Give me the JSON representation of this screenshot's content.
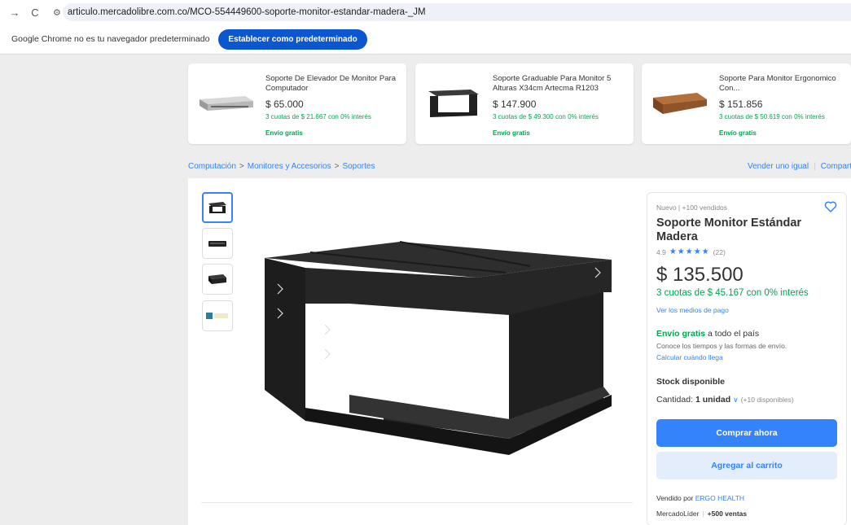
{
  "browser": {
    "url": "articulo.mercadolibre.com.co/MCO-554449600-soporte-monitor-estandar-madera-_JM",
    "default_msg": "Google Chrome no es tu navegador predeterminado",
    "default_btn": "Establecer como predeterminado"
  },
  "recommended": [
    {
      "title": "Soporte De Elevador De Monitor Para Computador",
      "price": "$ 65.000",
      "installments": "3 cuotas de $ 21.667 con 0% interés",
      "shipping": "Envío gratis"
    },
    {
      "title": "Soporte Graduable Para Monitor 5 Alturas X34cm Artecma R1203",
      "price": "$ 147.900",
      "installments": "3 cuotas de $ 49.300 con 0% interés",
      "shipping": "Envío gratis"
    },
    {
      "title": "Soporte Para Monitor Ergonomico Con...",
      "price": "$ 151.856",
      "installments": "3 cuotas de $ 50.619 con 0% interés",
      "shipping": "Envío gratis"
    }
  ],
  "breadcrumb": {
    "items": [
      "Computación",
      "Monitores y Accesorios",
      "Soportes"
    ],
    "sep": ">",
    "sell": "Vender uno igual",
    "share": "Compartir"
  },
  "product": {
    "status": "Nuevo  |  +100 vendidos",
    "title": "Soporte Monitor Estándar Madera",
    "rating": "4.9",
    "stars": "★★★★★",
    "reviews": "(22)",
    "price": "$ 135.500",
    "installments": "3 cuotas de $ 45.167 con 0% interés",
    "payment_link": "Ver los medios de pago",
    "ship_free": "Envío gratis",
    "ship_rest": " a todo el país",
    "ship_note": "Conoce los tiempos y las formas de envío.",
    "ship_link": "Calcular cuándo llega",
    "stock": "Stock disponible",
    "qty_label": "Cantidad: ",
    "qty_value": "1 unidad",
    "qty_avail": "(+10 disponibles)",
    "buy": "Comprar ahora",
    "cart": "Agregar al carrito",
    "seller_prefix": "Vendido por ",
    "seller": "ERGO HEALTH",
    "leader": "MercadoLíder",
    "sales": "+500 ventas",
    "thumb_logo": "ergo & health"
  },
  "colors": {
    "accent": "#3483fa",
    "green": "#00a650",
    "chrome_btn": "#0b57d0"
  }
}
